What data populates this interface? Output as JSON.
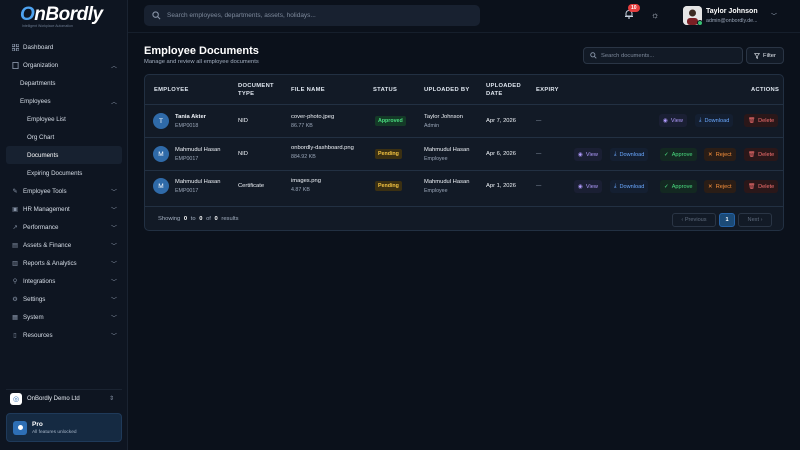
{
  "brand": {
    "logo_text_prefix": "O",
    "logo_text_rest": "nBordly",
    "tagline": "Intelligent Workplace Automation"
  },
  "sidebar": {
    "items": [
      {
        "label": "Dashboard",
        "icon": "grid-icon"
      },
      {
        "label": "Organization",
        "icon": "building-icon",
        "chevron": "up"
      },
      {
        "label": "Departments"
      },
      {
        "label": "Employees",
        "chevron": "up"
      },
      {
        "label": "Employee List"
      },
      {
        "label": "Org Chart"
      },
      {
        "label": "Documents",
        "active": true
      },
      {
        "label": "Expiring Documents"
      },
      {
        "label": "Employee Tools",
        "icon": "tools-icon",
        "chevron": "down"
      },
      {
        "label": "HR Management",
        "icon": "briefcase-icon",
        "chevron": "down"
      },
      {
        "label": "Performance",
        "icon": "chart-icon",
        "chevron": "down"
      },
      {
        "label": "Assets & Finance",
        "icon": "wallet-icon",
        "chevron": "down"
      },
      {
        "label": "Reports & Analytics",
        "icon": "report-icon",
        "chevron": "down"
      },
      {
        "label": "Integrations",
        "icon": "plug-icon",
        "chevron": "down"
      },
      {
        "label": "Settings",
        "icon": "gear-icon",
        "chevron": "down"
      },
      {
        "label": "System",
        "icon": "server-icon",
        "chevron": "down"
      },
      {
        "label": "Resources",
        "icon": "book-icon",
        "chevron": "down"
      }
    ],
    "org_name": "OnBordly Demo Ltd",
    "pro_title": "Pro",
    "pro_subtitle": "All features unlocked"
  },
  "header": {
    "search_placeholder": "Search employees, departments, assets, holidays...",
    "notification_count": "10",
    "user_name": "Taylor Johnson",
    "user_email": "admin@onbordly.de..."
  },
  "page": {
    "title": "Employee Documents",
    "subtitle": "Manage and review all employee documents",
    "doc_search_placeholder": "Search documents...",
    "filter_label": "Filter"
  },
  "table": {
    "headers": {
      "employee": "EMPLOYEE",
      "doc_type_1": "DOCUMENT",
      "doc_type_2": "TYPE",
      "file_name": "FILE NAME",
      "status": "STATUS",
      "uploaded_by": "UPLOADED BY",
      "uploaded_date_1": "UPLOADED",
      "uploaded_date_2": "DATE",
      "expiry": "EXPIRY",
      "actions": "ACTIONS"
    },
    "rows": [
      {
        "initial": "T",
        "name": "Tania Akter",
        "emp_id": "EMP0018",
        "doc_type": "NID",
        "file_name": "cover-photo.jpeg",
        "file_size": "86.77 KB",
        "status": "Approved",
        "uploaded_by": "Taylor Johnson",
        "uploader_role": "Admin",
        "date": "Apr 7, 2026",
        "expiry": "—",
        "actions": {
          "view": "View",
          "download": "Download",
          "delete": "Delete"
        }
      },
      {
        "initial": "M",
        "name": "Mahmudul Hasan",
        "emp_id": "EMP0017",
        "doc_type": "NID",
        "file_name": "onbordly-dashboard.png",
        "file_size": "884.92 KB",
        "status": "Pending",
        "uploaded_by": "Mahmudul Hasan",
        "uploader_role": "Employee",
        "date": "Apr 6, 2026",
        "expiry": "—",
        "actions": {
          "view": "View",
          "download": "Download",
          "approve": "Approve",
          "reject": "Reject",
          "delete": "Delete"
        }
      },
      {
        "initial": "M",
        "name": "Mahmudul Hasan",
        "emp_id": "EMP0017",
        "doc_type": "Certificate",
        "file_name": "images.png",
        "file_size": "4.87 KB",
        "status": "Pending",
        "uploaded_by": "Mahmudul Hasan",
        "uploader_role": "Employee",
        "date": "Apr 1, 2026",
        "expiry": "—",
        "actions": {
          "view": "View",
          "download": "Download",
          "approve": "Approve",
          "reject": "Reject",
          "delete": "Delete"
        }
      }
    ],
    "footer": {
      "showing": "Showing",
      "from": "0",
      "to_word": "to",
      "to": "0",
      "of_word": "of",
      "total": "0",
      "results": "results",
      "prev": "‹ Previous",
      "page": "1",
      "next": "Next ›"
    }
  }
}
